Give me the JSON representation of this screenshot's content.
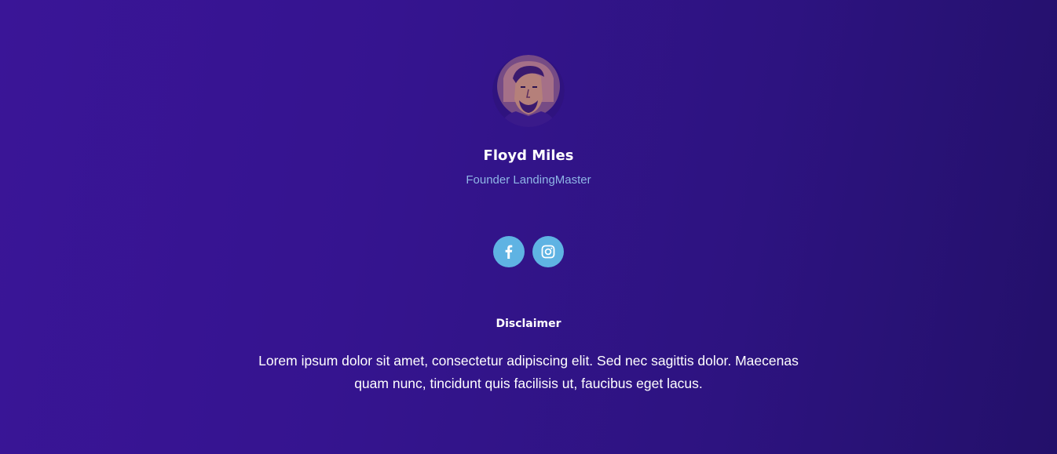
{
  "profile": {
    "name": "Floyd Miles",
    "role": "Founder LandingMaster"
  },
  "social": [
    {
      "icon": "facebook-icon"
    },
    {
      "icon": "instagram-icon"
    }
  ],
  "disclaimer": {
    "title": "Disclaimer",
    "text": "Lorem ipsum dolor sit amet, consectetur adipiscing elit. Sed nec sagittis dolor. Maecenas quam nunc, tincidunt quis facilisis ut, faucibus eget lacus."
  },
  "colors": {
    "background": "#35148f",
    "accent": "#5fb3e3",
    "subtitle": "#8fb6e6"
  }
}
